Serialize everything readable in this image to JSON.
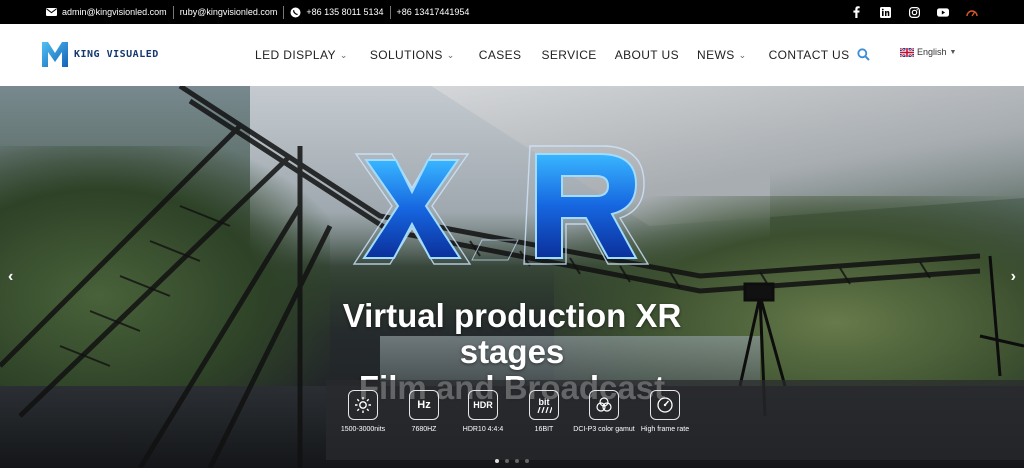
{
  "topbar": {
    "email1": "admin@kingvisionled.com",
    "email2": "ruby@kingvisionled.com",
    "phone1": "+86 135 8011 5134",
    "phone2": "+86 13417441954",
    "socials": [
      "facebook-icon",
      "linkedin-icon",
      "instagram-icon",
      "youtube-icon",
      "gauge-icon"
    ]
  },
  "nav": {
    "logo_text": "KING VISUALED",
    "items": [
      {
        "label": "LED DISPLAY",
        "dropdown": true
      },
      {
        "label": "SOLUTIONS",
        "dropdown": true
      },
      {
        "label": "CASES",
        "dropdown": false
      },
      {
        "label": "SERVICE",
        "dropdown": false
      },
      {
        "label": "ABOUT US",
        "dropdown": false
      },
      {
        "label": "NEWS",
        "dropdown": true
      },
      {
        "label": "CONTACT US",
        "dropdown": false
      }
    ],
    "language": "English",
    "accent_color": "#3b8ed6"
  },
  "hero": {
    "logo_text": "XR",
    "title_line1": "Virtual production XR stages",
    "title_line2": "Film and Broadcast",
    "features": [
      {
        "icon": "sun-icon",
        "icon_text": "",
        "label": "1500-3000nits"
      },
      {
        "icon": "hz-icon",
        "icon_text": "Hz",
        "label": "7680HZ"
      },
      {
        "icon": "hdr-icon",
        "icon_text": "HDR",
        "label": "HDR10 4:4:4"
      },
      {
        "icon": "bit-icon",
        "icon_text": "bit",
        "label": "16BIT"
      },
      {
        "icon": "color-gamut-icon",
        "icon_text": "",
        "label": "DCI-P3 color gamut"
      },
      {
        "icon": "speedometer-icon",
        "icon_text": "",
        "label": "High frame rate"
      }
    ],
    "slides_count": 4,
    "active_slide": 1
  }
}
